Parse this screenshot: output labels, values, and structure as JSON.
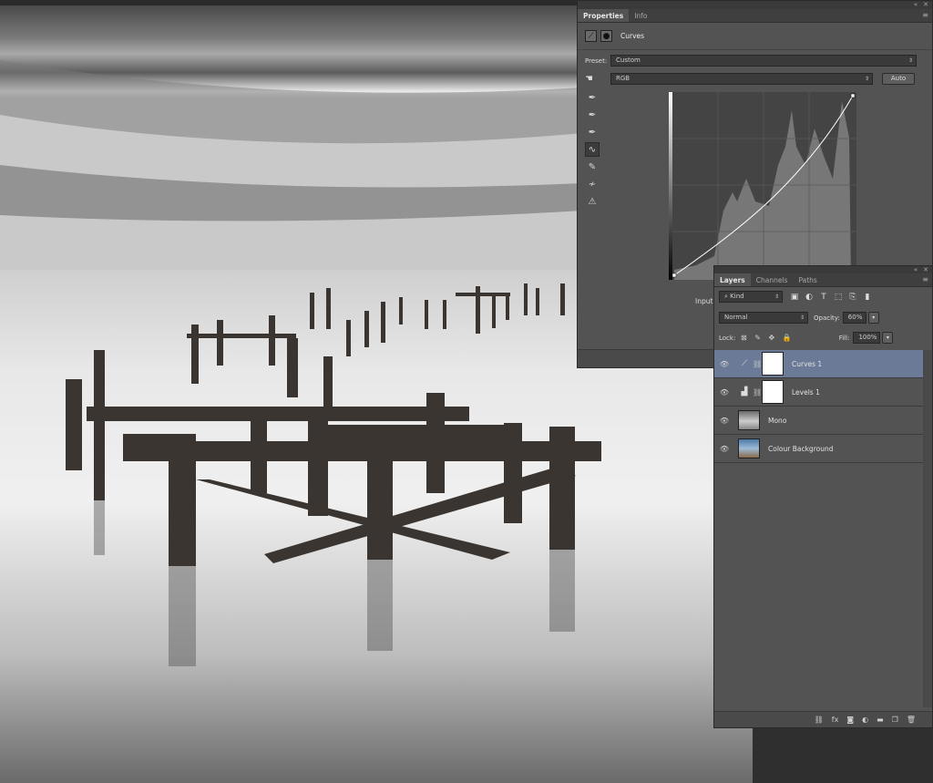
{
  "properties": {
    "tabs": [
      {
        "label": "Properties",
        "active": true
      },
      {
        "label": "Info",
        "active": false
      }
    ],
    "title": "Curves",
    "preset_label": "Preset:",
    "preset_value": "Custom",
    "channel_value": "RGB",
    "auto_label": "Auto",
    "input_label": "Input",
    "tools": [
      "eyedropper-icon",
      "eyedropper-gray-icon",
      "eyedropper-white-icon",
      "curve-point-icon",
      "pencil-icon",
      "smooth-icon",
      "clipping-warning-icon"
    ]
  },
  "layers": {
    "tabs": [
      {
        "label": "Layers",
        "active": true
      },
      {
        "label": "Channels",
        "active": false
      },
      {
        "label": "Paths",
        "active": false
      }
    ],
    "filter_value": "Kind",
    "blend_mode": "Normal",
    "opacity_label": "Opacity:",
    "opacity_value": "60%",
    "lock_label": "Lock:",
    "fill_label": "Fill:",
    "fill_value": "100%",
    "items": [
      {
        "name": "Curves 1",
        "type": "curves-adjustment",
        "selected": true
      },
      {
        "name": "Levels 1",
        "type": "levels-adjustment",
        "selected": false
      },
      {
        "name": "Mono",
        "type": "image",
        "selected": false
      },
      {
        "name": "Colour Background",
        "type": "image",
        "selected": false
      }
    ],
    "footer_icons": [
      "link-icon",
      "fx-icon",
      "mask-icon",
      "adjustment-icon",
      "folder-icon",
      "new-layer-icon",
      "trash-icon"
    ]
  },
  "colors": {
    "panel": "#535353",
    "selected_layer": "#6a7a97"
  }
}
